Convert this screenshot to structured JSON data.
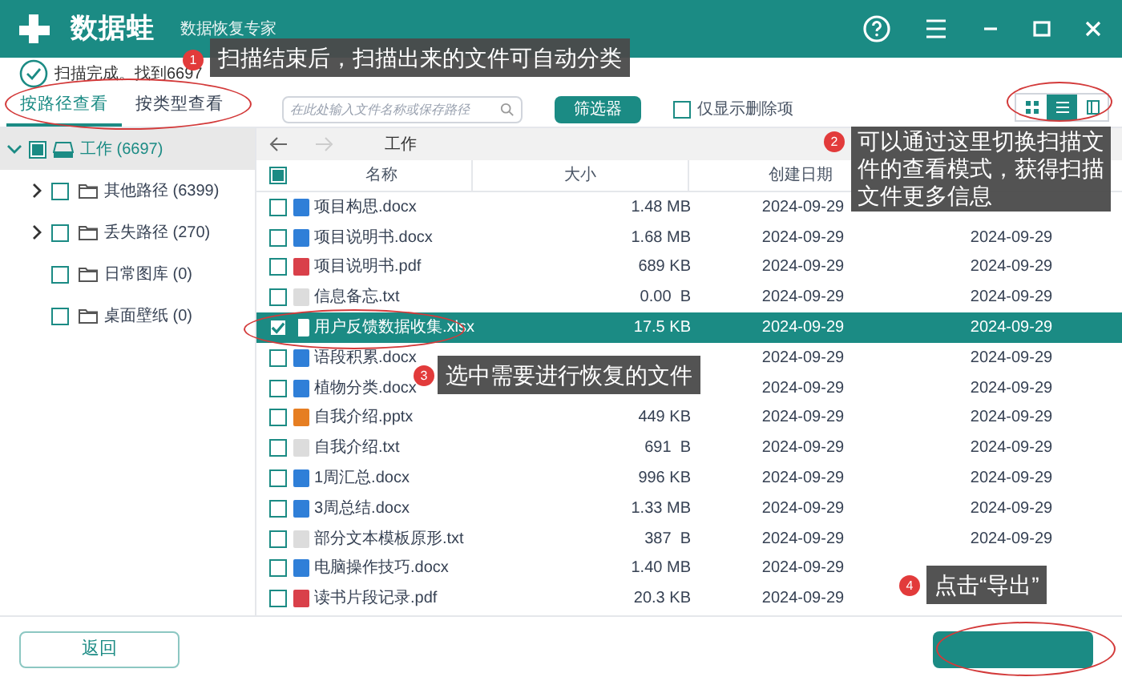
{
  "window": {
    "app_name": "数据蛙",
    "subtitle": "数据恢复专家"
  },
  "status": {
    "text": "扫描完成。找到6697"
  },
  "view_tabs": [
    {
      "label": "按路径查看",
      "selected": true
    },
    {
      "label": "按类型查看",
      "selected": false
    }
  ],
  "search": {
    "placeholder": "在此处输入文件名称或保存路径"
  },
  "filter_button": "筛选器",
  "deleted_only": {
    "label": "仅显示删除项",
    "checked": false
  },
  "view_modes": [
    {
      "kind": "grid",
      "selected": false
    },
    {
      "kind": "list",
      "selected": true
    },
    {
      "kind": "columns",
      "selected": false
    }
  ],
  "tree": [
    {
      "label": "工作 (6697)",
      "checked": false,
      "partial": true,
      "expanded": true,
      "selected": true,
      "children": [
        {
          "label": "其他路径 (6399)",
          "checked": false,
          "partial": false,
          "expandable": true
        },
        {
          "label": "丢失路径 (270)",
          "checked": false,
          "partial": false,
          "expandable": true
        },
        {
          "label": "日常图库 (0)",
          "checked": false,
          "partial": false,
          "expandable": false
        },
        {
          "label": "桌面壁纸 (0)",
          "checked": false,
          "partial": false,
          "expandable": false
        }
      ]
    }
  ],
  "breadcrumb": "工作",
  "table": {
    "select_all": {
      "checked": false,
      "partial": true
    },
    "columns": [
      "名称",
      "大小",
      "创建日期"
    ],
    "rows": [
      {
        "name": "项目构思.docx",
        "kind": "docx",
        "size": "1.48 MB",
        "created": "2024-09-29",
        "checked": false,
        "selected": false
      },
      {
        "name": "项目说明书.docx",
        "kind": "docx",
        "size": "1.68 MB",
        "created": "2024-09-29",
        "modified": "2024-09-29",
        "checked": false,
        "selected": false
      },
      {
        "name": "项目说明书.pdf",
        "kind": "pdf",
        "size": "689 KB",
        "created": "2024-09-29",
        "modified": "2024-09-29",
        "checked": false,
        "selected": false
      },
      {
        "name": "信息备忘.txt",
        "kind": "txt",
        "size": "0.00  B",
        "created": "2024-09-29",
        "modified": "2024-09-29",
        "checked": false,
        "selected": false
      },
      {
        "name": "用户反馈数据收集.xlsx",
        "kind": "xlsx",
        "size": "17.5 KB",
        "created": "2024-09-29",
        "modified": "2024-09-29",
        "checked": true,
        "selected": true
      },
      {
        "name": "语段积累.docx",
        "kind": "docx",
        "created": "2024-09-29",
        "modified": "2024-09-29",
        "checked": false,
        "selected": false
      },
      {
        "name": "植物分类.docx",
        "kind": "docx",
        "created": "2024-09-29",
        "modified": "2024-09-29",
        "checked": false,
        "selected": false
      },
      {
        "name": "自我介绍.pptx",
        "kind": "pptx",
        "size": "449 KB",
        "created": "2024-09-29",
        "modified": "2024-09-29",
        "checked": false,
        "selected": false
      },
      {
        "name": "自我介绍.txt",
        "kind": "txt",
        "size": "691  B",
        "created": "2024-09-29",
        "modified": "2024-09-29",
        "checked": false,
        "selected": false
      },
      {
        "name": "1周汇总.docx",
        "kind": "docx",
        "size": "996 KB",
        "created": "2024-09-29",
        "modified": "2024-09-29",
        "checked": false,
        "selected": false
      },
      {
        "name": "3周总结.docx",
        "kind": "docx",
        "size": "1.33 MB",
        "created": "2024-09-29",
        "modified": "2024-09-29",
        "checked": false,
        "selected": false
      },
      {
        "name": "部分文本模板原形.txt",
        "kind": "txt",
        "size": "387  B",
        "created": "2024-09-29",
        "modified": "2024-09-29",
        "checked": false,
        "selected": false
      },
      {
        "name": "电脑操作技巧.docx",
        "kind": "docx",
        "size": "1.40 MB",
        "created": "2024-09-29",
        "checked": false,
        "selected": false
      },
      {
        "name": "读书片段记录.pdf",
        "kind": "pdf",
        "size": "20.3 KB",
        "created": "2024-09-29",
        "checked": false,
        "selected": false
      }
    ]
  },
  "back_button": "返回",
  "callouts": [
    {
      "number": "1",
      "text": "扫描结束后，扫描出来的文件可自动分类"
    },
    {
      "number": "2",
      "text": "可以通过这里切换扫描文件的查看模式，获得扫描文件更多信息"
    },
    {
      "number": "3",
      "text": "选中需要进行恢复的文件"
    },
    {
      "number": "4",
      "text": "点击“导出”"
    }
  ]
}
